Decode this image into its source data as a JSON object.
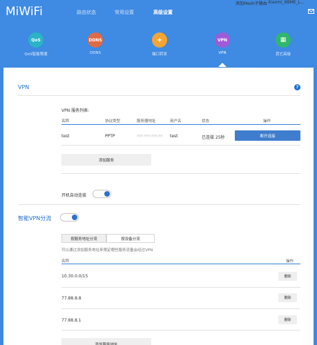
{
  "header": {
    "logo": "MiWiFi",
    "nav": [
      {
        "label": "路由状态",
        "active": false
      },
      {
        "label": "常用设置",
        "active": false
      },
      {
        "label": "高级设置",
        "active": true
      }
    ],
    "mesh_link": "添加Mesh子路由",
    "router_name": "Xiaomi_8BME_L..."
  },
  "features": [
    {
      "badge": "QoS",
      "label": "QoS智能限速",
      "color": "#2bb3c7"
    },
    {
      "badge": "DDNS",
      "label": "DDNS",
      "color": "#e06a43"
    },
    {
      "badge": "+",
      "label": "端口转发",
      "color": "#f2a533"
    },
    {
      "badge": "VPN",
      "label": "VPN",
      "color": "#a05ad8",
      "active": true
    },
    {
      "badge": "▦",
      "label": "其它高级",
      "color": "#2fb86c"
    }
  ],
  "vpn": {
    "title": "VPN",
    "help": "?",
    "list_label": "VPN 服务列表:",
    "columns": [
      "名称",
      "协议类型",
      "服务器地址",
      "用户名",
      "状态",
      "操作"
    ],
    "rows": [
      {
        "name": "test",
        "protocol": "PPTP",
        "server": "xxx.xxx.xxx.xx",
        "user": "test",
        "status": "已连接 25秒",
        "action": "断开连接"
      }
    ],
    "add_server_button": "添加服务",
    "autoconnect_label": "开机自动连接",
    "autoconnect_on": true
  },
  "smart_vpn": {
    "title": "智能VPN分流",
    "enabled": true,
    "tabs": [
      {
        "label": "按服务地址分流",
        "active": true
      },
      {
        "label": "按设备分流",
        "active": false
      }
    ],
    "hint": "可以通过添加服务地址来限定哪些服务流量会经过VPN",
    "columns": [
      "名称",
      "操作"
    ],
    "rows": [
      {
        "name": "10.30.0.0/15",
        "action": "删除"
      },
      {
        "name": "77.88.8.8",
        "action": "删除"
      },
      {
        "name": "77.88.8.1",
        "action": "删除"
      }
    ],
    "add_button": "添加服务地址"
  }
}
